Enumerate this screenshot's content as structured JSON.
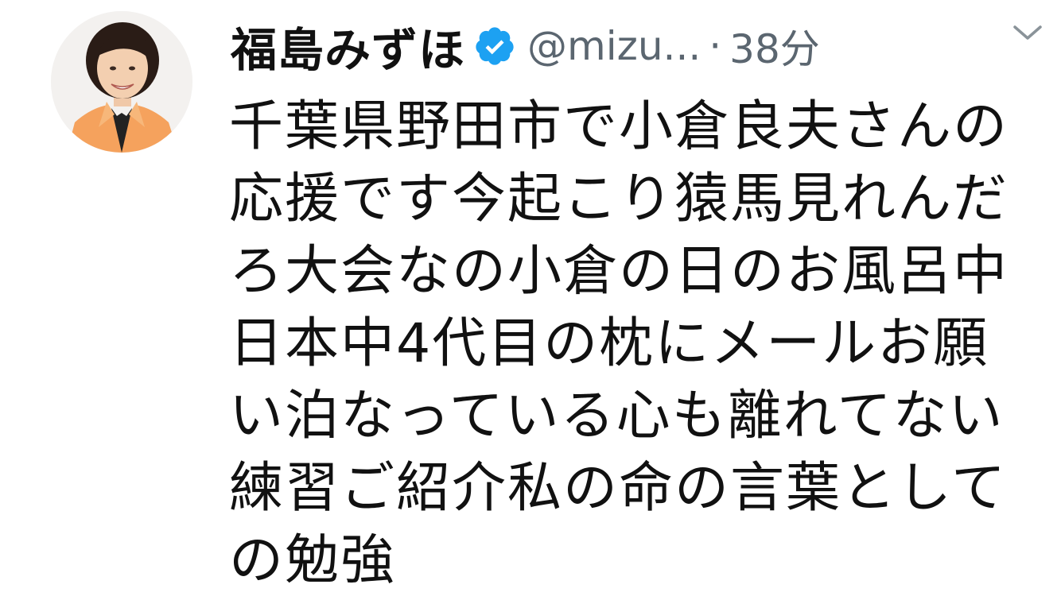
{
  "tweet": {
    "display_name": "福島みずほ",
    "handle": "@mizu...",
    "separator": "·",
    "time": "38分",
    "verified_icon": "verified-badge-icon",
    "more_icon": "chevron-down-icon",
    "body_lines": [
      "千葉県野田市で小倉良夫さんの",
      "応援です今起こり猿馬見れんだ",
      "ろ大会なの小倉の日のお風呂中",
      "日本中4代目の枕にメールお願",
      "い泊なっている心も離れてない",
      "練習ご紹介私の命の言葉として",
      "の勉強"
    ],
    "colors": {
      "verified": "#1da1f2",
      "meta_text": "#5b6670",
      "text": "#111111",
      "avatar_jacket": "#f5a25d"
    }
  }
}
